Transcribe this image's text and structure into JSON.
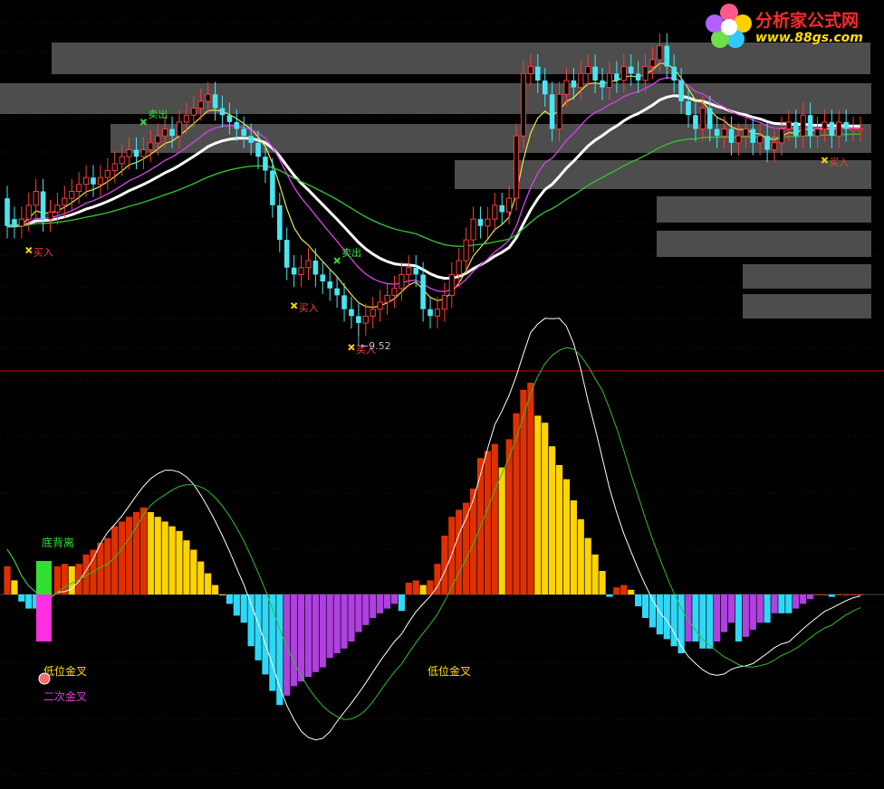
{
  "watermark": {
    "title": "分析家公式网",
    "url": "www.88gs.com"
  },
  "colors": {
    "background": "#000000",
    "candle_up": "#ff3b3b",
    "candle_down": "#49e6f0",
    "ma_white": "#ffffff",
    "ma_yellow": "#e8e84a",
    "ma_magenta": "#d040e0",
    "ma_green": "#30c030",
    "zone_gray": "#4d4d4d",
    "hist_red": "#e03000",
    "hist_yellow": "#ffd400",
    "hist_cyan": "#30d8f8",
    "hist_violet": "#b040e0",
    "divider": "#b00000"
  },
  "chart_data": [
    {
      "type": "candlestick",
      "panel": "price",
      "low_marker": "9.52",
      "x": [
        0,
        1,
        2,
        3,
        4,
        5,
        6,
        7,
        8,
        9,
        10,
        11,
        12,
        13,
        14,
        15,
        16,
        17,
        18,
        19,
        20,
        21,
        22,
        23,
        24,
        25,
        26,
        27,
        28,
        29,
        30,
        31,
        32,
        33,
        34,
        35,
        36,
        37,
        38,
        39,
        40,
        41,
        42,
        43,
        44,
        45,
        46,
        47,
        48,
        49,
        50,
        51,
        52,
        53,
        54,
        55,
        56,
        57,
        58,
        59,
        60,
        61,
        62,
        63,
        64,
        65,
        66,
        67,
        68,
        69,
        70,
        71,
        72,
        73,
        74,
        75,
        76,
        77,
        78,
        79,
        80,
        81,
        82,
        83,
        84,
        85,
        86,
        87,
        88,
        89,
        90,
        91,
        92,
        93,
        94,
        95,
        96,
        97,
        98,
        99,
        100,
        101,
        102,
        103,
        104,
        105,
        106,
        107,
        108,
        109,
        110,
        111,
        112,
        113,
        114,
        115,
        116,
        117,
        118,
        119
      ],
      "open": [
        11.6,
        11.3,
        11.2,
        11.3,
        11.5,
        11.7,
        11.3,
        11.4,
        11.5,
        11.6,
        11.7,
        11.8,
        11.9,
        11.8,
        11.9,
        12.0,
        12.1,
        12.2,
        12.3,
        12.2,
        12.3,
        12.4,
        12.5,
        12.6,
        12.5,
        12.7,
        12.8,
        12.9,
        13.0,
        13.1,
        12.9,
        12.8,
        12.7,
        12.6,
        12.5,
        12.4,
        12.2,
        12.0,
        11.5,
        11.0,
        10.6,
        10.5,
        10.6,
        10.7,
        10.5,
        10.4,
        10.3,
        10.2,
        10.0,
        9.9,
        9.8,
        9.9,
        10.0,
        10.1,
        10.2,
        10.3,
        10.5,
        10.6,
        10.5,
        10.0,
        9.9,
        10.0,
        10.2,
        10.5,
        10.7,
        11.0,
        11.3,
        11.2,
        11.3,
        11.5,
        11.4,
        11.6,
        12.5,
        13.4,
        13.5,
        13.3,
        13.1,
        12.6,
        13.1,
        13.3,
        13.2,
        13.4,
        13.5,
        13.3,
        13.2,
        13.4,
        13.3,
        13.5,
        13.4,
        13.3,
        13.5,
        13.6,
        13.8,
        13.5,
        13.3,
        13.0,
        12.8,
        12.6,
        12.9,
        12.6,
        12.5,
        12.6,
        12.4,
        12.5,
        12.6,
        12.4,
        12.5,
        12.3,
        12.4,
        12.6,
        12.7,
        12.5,
        12.8,
        12.5,
        12.6,
        12.7,
        12.5,
        12.7,
        12.6,
        12.6
      ],
      "close": [
        11.2,
        11.2,
        11.3,
        11.5,
        11.7,
        11.3,
        11.4,
        11.5,
        11.6,
        11.7,
        11.8,
        11.9,
        11.8,
        11.9,
        12.0,
        12.1,
        12.2,
        12.3,
        12.2,
        12.3,
        12.4,
        12.5,
        12.6,
        12.5,
        12.7,
        12.8,
        12.9,
        13.0,
        13.1,
        12.9,
        12.8,
        12.7,
        12.6,
        12.5,
        12.4,
        12.2,
        12.0,
        11.5,
        11.0,
        10.6,
        10.5,
        10.6,
        10.7,
        10.5,
        10.4,
        10.3,
        10.2,
        10.0,
        9.9,
        9.8,
        9.9,
        10.0,
        10.1,
        10.2,
        10.3,
        10.5,
        10.6,
        10.5,
        10.0,
        9.9,
        10.0,
        10.2,
        10.5,
        10.7,
        11.0,
        11.3,
        11.2,
        11.3,
        11.5,
        11.4,
        11.6,
        12.5,
        13.4,
        13.5,
        13.3,
        13.1,
        12.6,
        13.1,
        13.3,
        13.2,
        13.4,
        13.5,
        13.3,
        13.2,
        13.4,
        13.3,
        13.5,
        13.4,
        13.3,
        13.5,
        13.6,
        13.8,
        13.5,
        13.3,
        13.0,
        12.8,
        12.6,
        12.9,
        12.6,
        12.5,
        12.6,
        12.4,
        12.5,
        12.6,
        12.4,
        12.5,
        12.3,
        12.4,
        12.6,
        12.7,
        12.5,
        12.8,
        12.5,
        12.6,
        12.7,
        12.5,
        12.7,
        12.6,
        12.6,
        12.6
      ],
      "series": [
        {
          "color": "ma_white"
        },
        {
          "color": "ma_yellow"
        },
        {
          "color": "ma_magenta"
        },
        {
          "color": "ma_green"
        }
      ],
      "annotations": [
        {
          "x": 19,
          "text": "卖出",
          "color": "#30e030",
          "side": "above"
        },
        {
          "x": 3,
          "text": "买入",
          "color": "#ff3b3b",
          "side": "below"
        },
        {
          "x": 40,
          "text": "买入",
          "color": "#ff3b3b",
          "side": "below"
        },
        {
          "x": 46,
          "text": "卖出",
          "color": "#30e030",
          "side": "above"
        },
        {
          "x": 48,
          "text": "买入",
          "color": "#ff3b3b",
          "side": "below"
        },
        {
          "x": 114,
          "text": "买入",
          "color": "#ff3b3b",
          "side": "below"
        }
      ],
      "grid": true
    },
    {
      "type": "bar",
      "panel": "macd",
      "x": [
        0,
        1,
        2,
        3,
        4,
        5,
        6,
        7,
        8,
        9,
        10,
        11,
        12,
        13,
        14,
        15,
        16,
        17,
        18,
        19,
        20,
        21,
        22,
        23,
        24,
        25,
        26,
        27,
        28,
        29,
        30,
        31,
        32,
        33,
        34,
        35,
        36,
        37,
        38,
        39,
        40,
        41,
        42,
        43,
        44,
        45,
        46,
        47,
        48,
        49,
        50,
        51,
        52,
        53,
        54,
        55,
        56,
        57,
        58,
        59,
        60,
        61,
        62,
        63,
        64,
        65,
        66,
        67,
        68,
        69,
        70,
        71,
        72,
        73,
        74,
        75,
        76,
        77,
        78,
        79,
        80,
        81,
        82,
        83,
        84,
        85,
        86,
        87,
        88,
        89,
        90,
        91,
        92,
        93,
        94,
        95,
        96,
        97,
        98,
        99,
        100,
        101,
        102,
        103,
        104,
        105,
        106,
        107,
        108,
        109,
        110,
        111,
        112,
        113,
        114,
        115,
        116,
        117,
        118,
        119
      ],
      "values": [
        0.12,
        0.06,
        -0.03,
        -0.06,
        -0.06,
        -0.1,
        0.0,
        0.12,
        0.13,
        0.12,
        0.13,
        0.17,
        0.19,
        0.22,
        0.24,
        0.29,
        0.31,
        0.33,
        0.35,
        0.37,
        0.35,
        0.33,
        0.31,
        0.29,
        0.27,
        0.23,
        0.19,
        0.14,
        0.09,
        0.04,
        0.0,
        -0.04,
        -0.09,
        -0.12,
        -0.22,
        -0.28,
        -0.34,
        -0.41,
        -0.47,
        -0.43,
        -0.39,
        -0.37,
        -0.35,
        -0.33,
        -0.31,
        -0.27,
        -0.25,
        -0.23,
        -0.2,
        -0.16,
        -0.13,
        -0.1,
        -0.08,
        -0.06,
        -0.04,
        -0.07,
        0.05,
        0.06,
        0.04,
        0.06,
        0.13,
        0.25,
        0.33,
        0.36,
        0.39,
        0.45,
        0.58,
        0.61,
        0.64,
        0.54,
        0.66,
        0.77,
        0.87,
        0.9,
        0.76,
        0.73,
        0.63,
        0.55,
        0.49,
        0.4,
        0.32,
        0.24,
        0.17,
        0.1,
        -0.01,
        0.03,
        0.04,
        0.02,
        -0.05,
        -0.1,
        -0.14,
        -0.17,
        -0.19,
        -0.22,
        -0.25,
        -0.2,
        -0.2,
        -0.23,
        -0.23,
        -0.2,
        -0.16,
        -0.12,
        -0.2,
        -0.18,
        -0.15,
        -0.12,
        -0.12,
        -0.08,
        -0.08,
        -0.08,
        -0.06,
        -0.04,
        -0.02,
        0.0,
        0.0,
        -0.01,
        0.0,
        0.0,
        0.0,
        0.0
      ],
      "series": [
        {
          "color": "#ffffff"
        },
        {
          "color": "#30c030"
        }
      ],
      "annotations": [
        {
          "text": "底背离",
          "color": "#30e030"
        },
        {
          "text": "低位金叉",
          "color": "#ffe000"
        },
        {
          "text": "二次金叉",
          "color": "#e040e0"
        },
        {
          "text": "低位金叉",
          "color": "#ffe000"
        }
      ],
      "grid": true
    }
  ]
}
